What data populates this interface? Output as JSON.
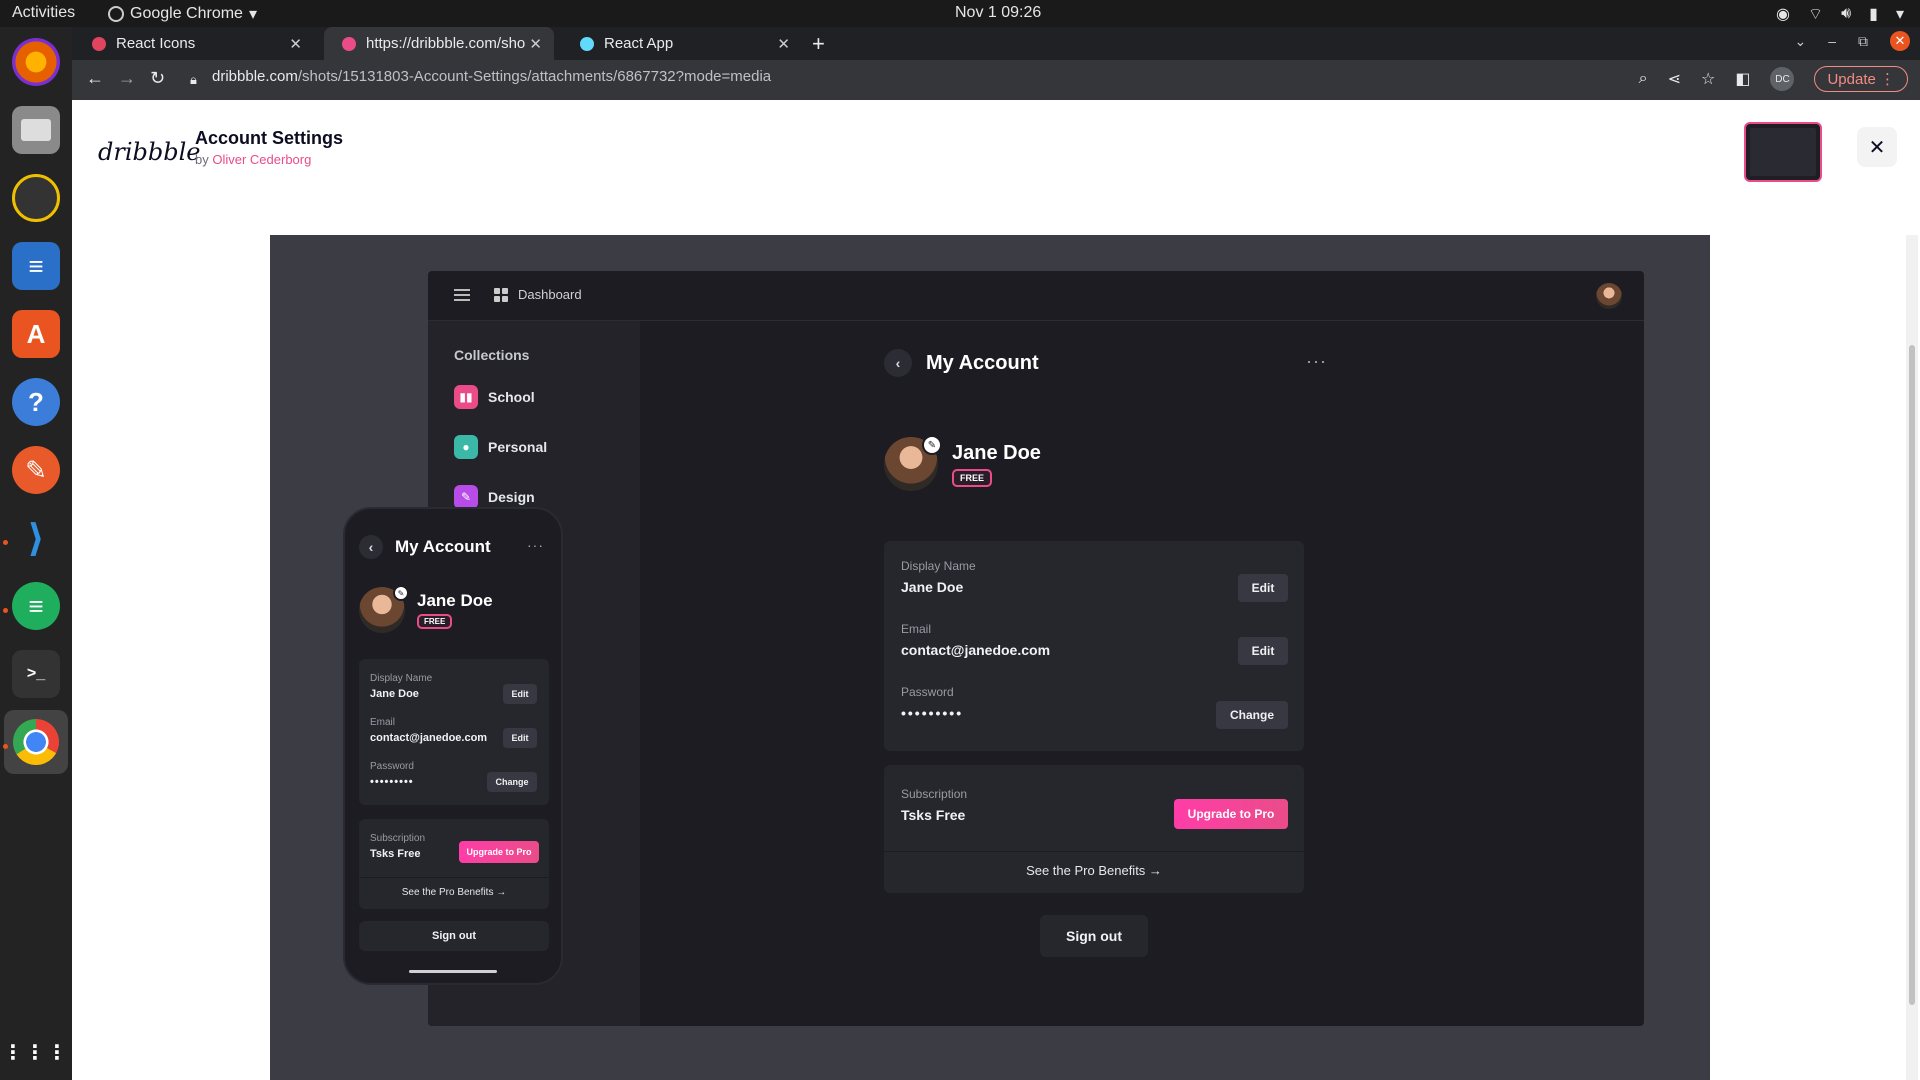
{
  "system": {
    "activities": "Activities",
    "app_name": "Google Chrome",
    "clock": "Nov 1  09:26"
  },
  "browser": {
    "tabs": [
      {
        "title": "React Icons",
        "color": "#e0445f"
      },
      {
        "title": "https://dribbble.com/sho",
        "color": "#ea4c89"
      },
      {
        "title": "React App",
        "color": "#61dafb"
      }
    ],
    "new_tab": "+",
    "url_domain": "dribbble.com",
    "url_path": "/shots/15131803-Account-Settings/attachments/6867732?mode=media",
    "profile_initials": "DC",
    "update_label": "Update"
  },
  "shot": {
    "logo": "dribbble",
    "title": "Account Settings",
    "by_prefix": "by",
    "author": "Oliver Cederborg",
    "close": "✕"
  },
  "mockup": {
    "top_label": "Dashboard",
    "collections_title": "Collections",
    "collections": [
      {
        "label": "School",
        "color": "#ea4c89",
        "icon": "book-icon"
      },
      {
        "label": "Personal",
        "color": "#3bb8a8",
        "icon": "person-icon"
      },
      {
        "label": "Design",
        "color": "#b84ce8",
        "icon": "pencil-icon"
      }
    ],
    "account_title": "My Account",
    "name": "Jane Doe",
    "plan_badge": "FREE",
    "fields": [
      {
        "label": "Display Name",
        "value": "Jane Doe",
        "action": "Edit"
      },
      {
        "label": "Email",
        "value": "contact@janedoe.com",
        "action": "Edit"
      },
      {
        "label": "Password",
        "value": "•••••••••",
        "action": "Change"
      }
    ],
    "subscription_label": "Subscription",
    "subscription_value": "Tsks Free",
    "upgrade_label": "Upgrade to Pro",
    "benefits_label": "See the Pro Benefits  →",
    "signout_label": "Sign out"
  }
}
